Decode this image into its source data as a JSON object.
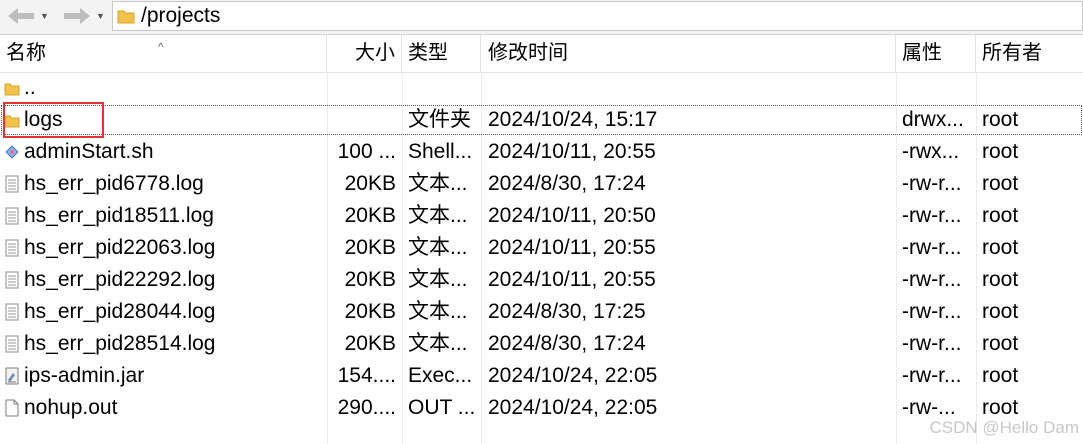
{
  "toolbar": {
    "back_icon": "arrow-left-icon",
    "forward_icon": "arrow-right-icon",
    "path": "/projects"
  },
  "columns": {
    "name": "名称",
    "size": "大小",
    "type": "类型",
    "modified": "修改时间",
    "attributes": "属性",
    "owner": "所有者"
  },
  "parent_row": {
    "name": "..",
    "icon": "folder-icon"
  },
  "rows": [
    {
      "name": "logs",
      "size": "",
      "type": "文件夹",
      "modified": "2024/10/24, 15:17",
      "perm": "drwx...",
      "owner": "root",
      "icon": "folder-icon"
    },
    {
      "name": "adminStart.sh",
      "size": "100 ...",
      "type": "Shell...",
      "modified": "2024/10/11, 20:55",
      "perm": "-rwx...",
      "owner": "root",
      "icon": "script-icon"
    },
    {
      "name": "hs_err_pid6778.log",
      "size": "20KB",
      "type": "文本...",
      "modified": "2024/8/30, 17:24",
      "perm": "-rw-r...",
      "owner": "root",
      "icon": "text-file-icon"
    },
    {
      "name": "hs_err_pid18511.log",
      "size": "20KB",
      "type": "文本...",
      "modified": "2024/10/11, 20:50",
      "perm": "-rw-r...",
      "owner": "root",
      "icon": "text-file-icon"
    },
    {
      "name": "hs_err_pid22063.log",
      "size": "20KB",
      "type": "文本...",
      "modified": "2024/10/11, 20:55",
      "perm": "-rw-r...",
      "owner": "root",
      "icon": "text-file-icon"
    },
    {
      "name": "hs_err_pid22292.log",
      "size": "20KB",
      "type": "文本...",
      "modified": "2024/10/11, 20:55",
      "perm": "-rw-r...",
      "owner": "root",
      "icon": "text-file-icon"
    },
    {
      "name": "hs_err_pid28044.log",
      "size": "20KB",
      "type": "文本...",
      "modified": "2024/8/30, 17:25",
      "perm": "-rw-r...",
      "owner": "root",
      "icon": "text-file-icon"
    },
    {
      "name": "hs_err_pid28514.log",
      "size": "20KB",
      "type": "文本...",
      "modified": "2024/8/30, 17:24",
      "perm": "-rw-r...",
      "owner": "root",
      "icon": "text-file-icon"
    },
    {
      "name": "ips-admin.jar",
      "size": "154....",
      "type": "Exec...",
      "modified": "2024/10/24, 22:05",
      "perm": "-rw-r...",
      "owner": "root",
      "icon": "jar-file-icon"
    },
    {
      "name": "nohup.out",
      "size": "290....",
      "type": "OUT ...",
      "modified": "2024/10/24, 22:05",
      "perm": "-rw-...",
      "owner": "root",
      "icon": "blank-file-icon"
    }
  ],
  "watermark": "CSDN @Hello Dam"
}
